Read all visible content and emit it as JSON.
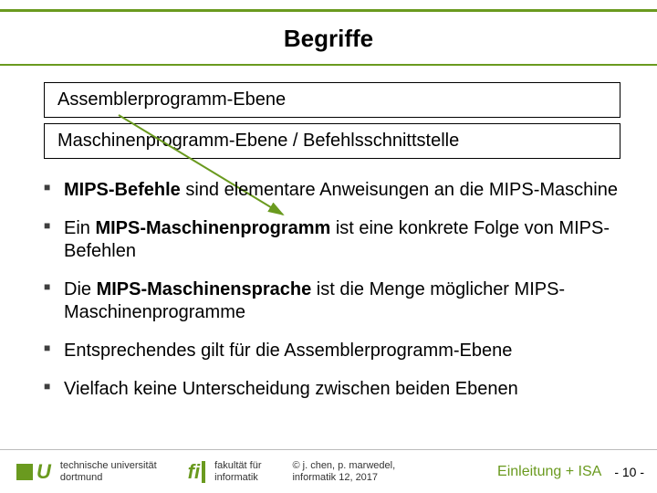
{
  "title": "Begriffe",
  "layers": {
    "box1": "Assemblerprogramm-Ebene",
    "box2": "Maschinenprogramm-Ebene / Befehlsschnittstelle"
  },
  "bullets": [
    {
      "bold": "MIPS-Befehle",
      "rest": " sind elementare Anweisungen an die MIPS-Maschine"
    },
    {
      "pre": "Ein ",
      "bold": "MIPS-Maschinenprogramm",
      "rest": " ist eine konkrete Folge von MIPS-Befehlen"
    },
    {
      "pre": "Die ",
      "bold": "MIPS-Maschinensprache",
      "rest": " ist die Menge möglicher MIPS-Maschinenprogramme"
    },
    {
      "pre": "",
      "bold": "",
      "rest": "Entsprechendes gilt für die Assemblerprogramm-Ebene"
    },
    {
      "pre": "",
      "bold": "",
      "rest": "Vielfach keine Unterscheidung zwischen beiden Ebenen"
    }
  ],
  "footer": {
    "tu_letter": "U",
    "uni_line1": "technische universität",
    "uni_line2": "dortmund",
    "fi_letter": "fi",
    "fac_line1": "fakultät für",
    "fac_line2": "informatik",
    "copy_line1": "© j. chen, p. marwedel,",
    "copy_line2": "informatik 12,  2017",
    "section": "Einleitung + ISA",
    "page": "-  10 -"
  }
}
